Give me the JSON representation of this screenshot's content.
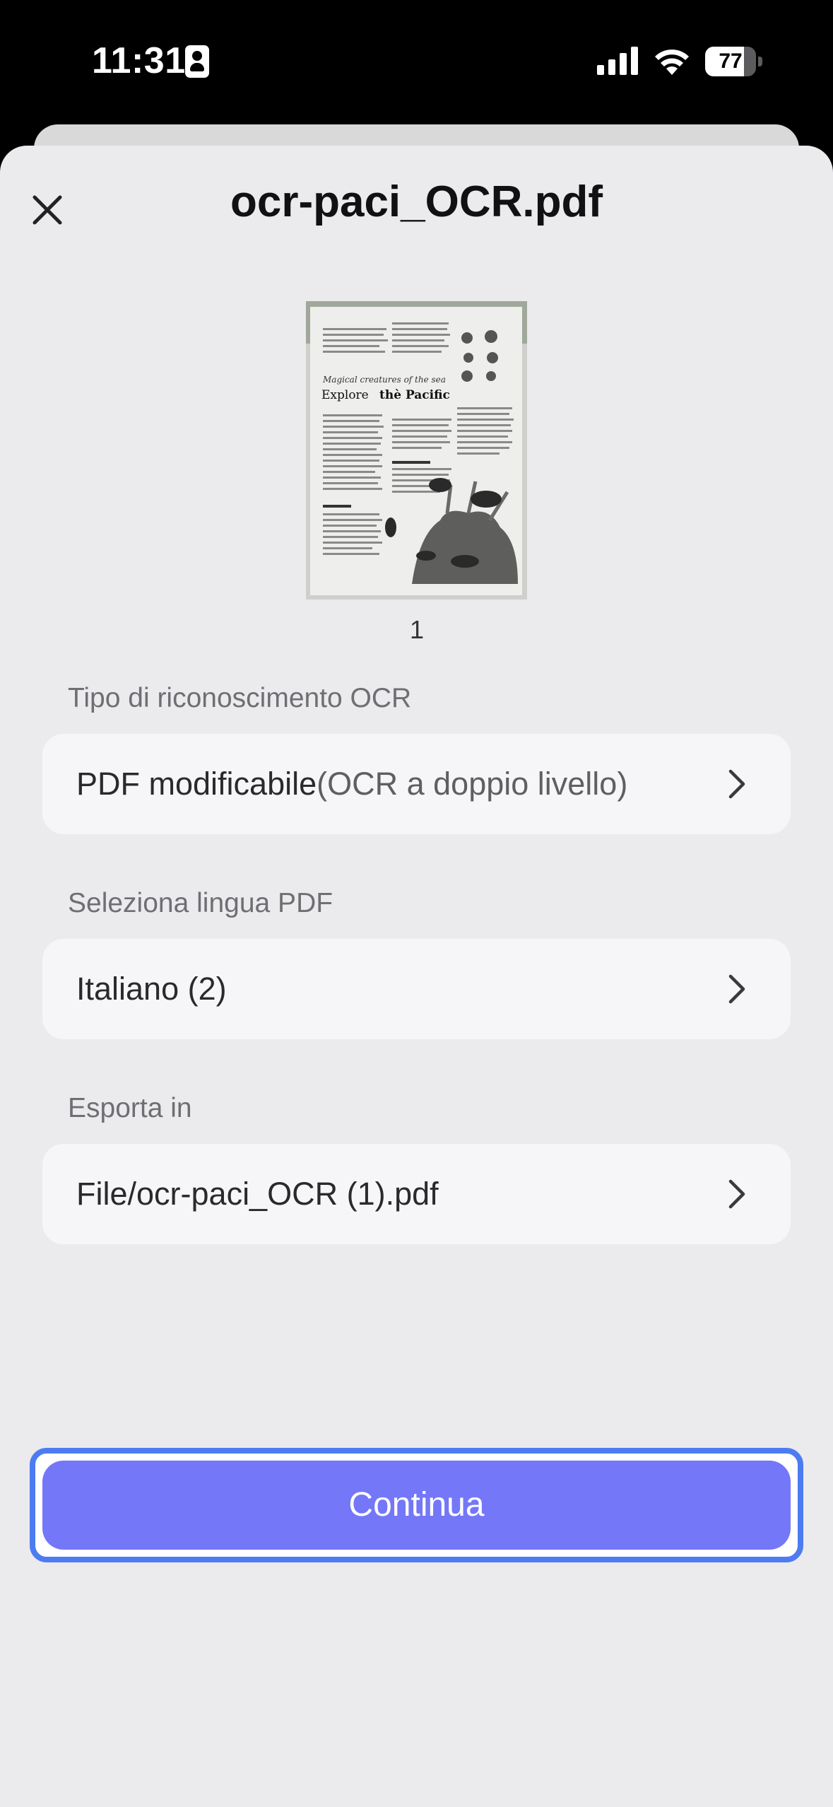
{
  "status_bar": {
    "time": "11:31",
    "battery_percent": "77",
    "battery_level": 0.77,
    "icons": [
      "id-card-icon",
      "cellular-signal-icon",
      "wifi-icon",
      "battery-icon"
    ]
  },
  "header": {
    "title": "ocr-paci_OCR.pdf",
    "close_icon": "close-icon"
  },
  "preview": {
    "page_number": "1",
    "thumb_heading_small": "Magical creatures of the sea",
    "thumb_heading_large_1": "Explore",
    "thumb_heading_large_2": "thè Pacific"
  },
  "sections": [
    {
      "label": "Tipo di riconoscimento OCR",
      "value_main": "PDF modificabile",
      "value_secondary": "(OCR a doppio livello)"
    },
    {
      "label": "Seleziona lingua PDF",
      "value_main": "Italiano (2)",
      "value_secondary": ""
    },
    {
      "label": "Esporta in",
      "value_main": "File/ocr-paci_OCR (1).pdf",
      "value_secondary": ""
    }
  ],
  "footer": {
    "continue_label": "Continua"
  },
  "colors": {
    "accent": "#7477f8",
    "focus_ring": "#4d7cf2",
    "sheet_bg": "#ebeaed",
    "row_bg": "#f6f5f7"
  }
}
